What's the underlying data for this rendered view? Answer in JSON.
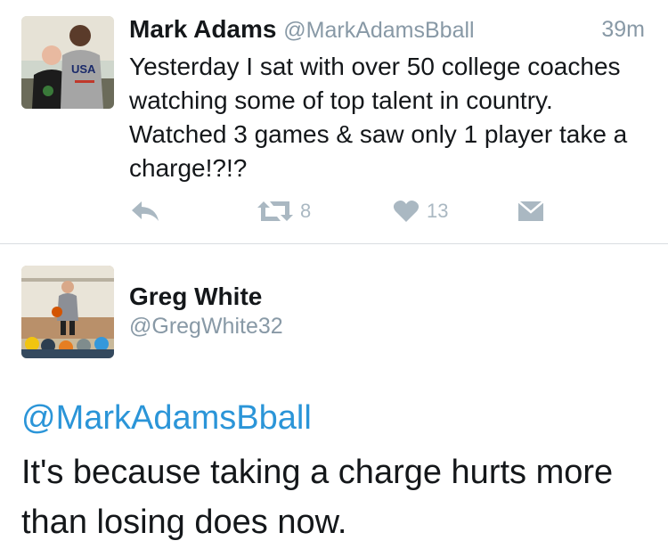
{
  "tweet1": {
    "name": "Mark Adams",
    "handle": "@MarkAdamsBball",
    "time": "39m",
    "text": "Yesterday I sat with over 50 college coaches watching some of top talent in country. Watched 3 games & saw only 1 player take a charge!?!?",
    "avatar_text": "USA",
    "retweet_count": "8",
    "like_count": "13"
  },
  "tweet2": {
    "name": "Greg White",
    "handle": "@GregWhite32",
    "mention": "@MarkAdamsBball",
    "text": "It's because taking a charge hurts more than losing does now."
  },
  "icons": [
    "reply-icon",
    "retweet-icon",
    "like-icon",
    "direct-message-icon"
  ],
  "colors": {
    "link": "#2b95d8",
    "muted": "#8899a6",
    "action_gray": "#aab8c2",
    "text": "#14171a"
  }
}
